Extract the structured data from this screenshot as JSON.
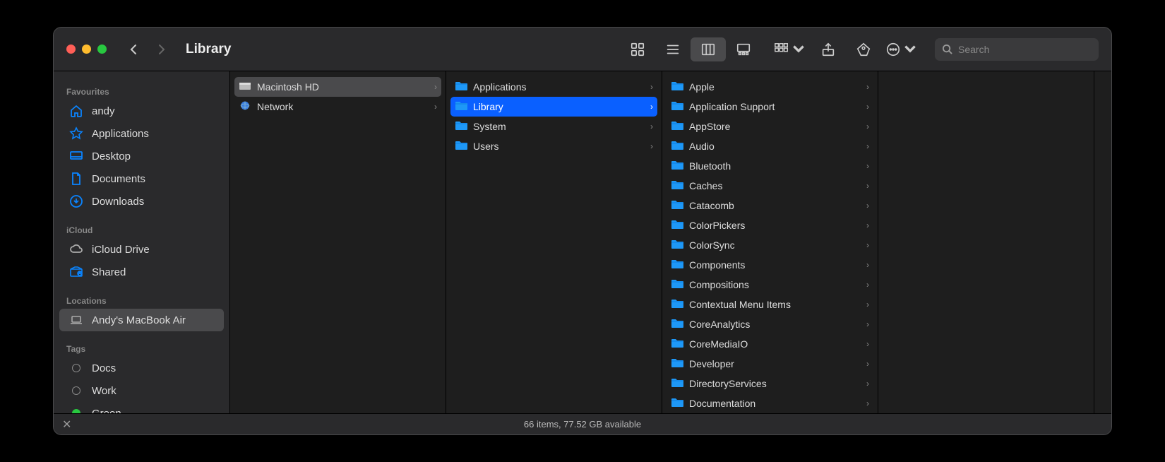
{
  "title": "Library",
  "search_placeholder": "Search",
  "status": "66 items, 77.52 GB available",
  "sidebar": {
    "sections": [
      {
        "title": "Favourites",
        "items": [
          {
            "label": "andy",
            "icon": "home"
          },
          {
            "label": "Applications",
            "icon": "apps"
          },
          {
            "label": "Desktop",
            "icon": "desktop"
          },
          {
            "label": "Documents",
            "icon": "doc"
          },
          {
            "label": "Downloads",
            "icon": "download"
          }
        ]
      },
      {
        "title": "iCloud",
        "items": [
          {
            "label": "iCloud Drive",
            "icon": "cloud"
          },
          {
            "label": "Shared",
            "icon": "shared"
          }
        ]
      },
      {
        "title": "Locations",
        "items": [
          {
            "label": "Andy's MacBook Air",
            "icon": "laptop",
            "selected": true
          }
        ]
      },
      {
        "title": "Tags",
        "items": [
          {
            "label": "Docs",
            "icon": "tag"
          },
          {
            "label": "Work",
            "icon": "tag"
          },
          {
            "label": "Green",
            "icon": "tag-green"
          }
        ]
      }
    ]
  },
  "columns": [
    {
      "items": [
        {
          "label": "Macintosh HD",
          "icon": "hd",
          "selected": "gray"
        },
        {
          "label": "Network",
          "icon": "network"
        }
      ]
    },
    {
      "items": [
        {
          "label": "Applications",
          "icon": "folder"
        },
        {
          "label": "Library",
          "icon": "folder",
          "selected": "blue"
        },
        {
          "label": "System",
          "icon": "folder"
        },
        {
          "label": "Users",
          "icon": "folder"
        }
      ]
    },
    {
      "items": [
        {
          "label": "Apple",
          "icon": "folder"
        },
        {
          "label": "Application Support",
          "icon": "folder"
        },
        {
          "label": "AppStore",
          "icon": "folder"
        },
        {
          "label": "Audio",
          "icon": "folder"
        },
        {
          "label": "Bluetooth",
          "icon": "folder"
        },
        {
          "label": "Caches",
          "icon": "folder"
        },
        {
          "label": "Catacomb",
          "icon": "folder"
        },
        {
          "label": "ColorPickers",
          "icon": "folder"
        },
        {
          "label": "ColorSync",
          "icon": "folder"
        },
        {
          "label": "Components",
          "icon": "folder"
        },
        {
          "label": "Compositions",
          "icon": "folder"
        },
        {
          "label": "Contextual Menu Items",
          "icon": "folder"
        },
        {
          "label": "CoreAnalytics",
          "icon": "folder"
        },
        {
          "label": "CoreMediaIO",
          "icon": "folder"
        },
        {
          "label": "Developer",
          "icon": "folder"
        },
        {
          "label": "DirectoryServices",
          "icon": "folder"
        },
        {
          "label": "Documentation",
          "icon": "folder"
        }
      ]
    },
    {
      "items": []
    }
  ]
}
